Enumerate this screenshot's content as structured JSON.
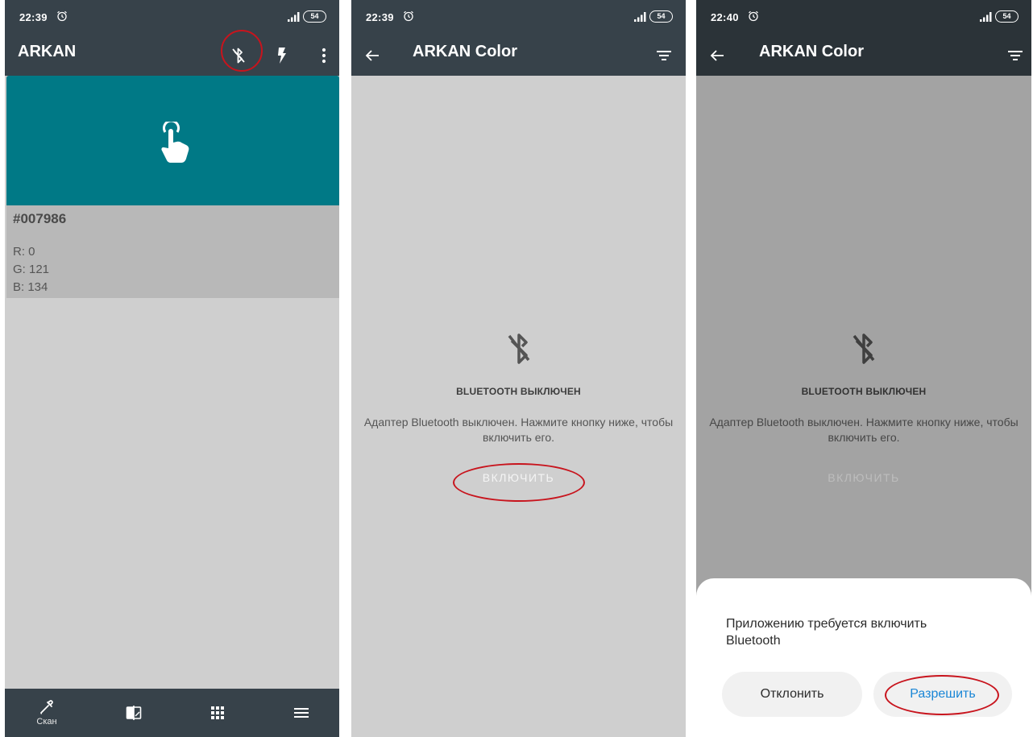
{
  "colors": {
    "bar": "#37424a",
    "swatch": "#007986",
    "highlight": "#c8141d",
    "accent": "#1a86d6"
  },
  "status": {
    "battery": "54"
  },
  "panel1": {
    "time": "22:39",
    "title": "ARKAN",
    "actions": [
      "bluetooth-off-icon",
      "flash-icon",
      "more-vert-icon"
    ],
    "hex": "#007986",
    "r": "R: 0",
    "g": "G: 121",
    "b": "B: 134",
    "nav": {
      "scan_label": "Скан",
      "icons": [
        "eyedropper-icon",
        "compare-icon",
        "grid-icon",
        "menu-icon"
      ]
    }
  },
  "panel2": {
    "time": "22:39",
    "title": "ARKAN Color",
    "bt_title": "BLUETOOTH ВЫКЛЮЧЕН",
    "bt_desc": "Адаптер Bluetooth выключен. Нажмите кнопку ниже, чтобы включить его.",
    "enable_label": "ВКЛЮЧИТЬ"
  },
  "panel3": {
    "time": "22:40",
    "title": "ARKAN Color",
    "bt_title": "BLUETOOTH ВЫКЛЮЧЕН",
    "bt_desc": "Адаптер Bluetooth выключен. Нажмите кнопку ниже, чтобы включить его.",
    "enable_label": "ВКЛЮЧИТЬ",
    "dialog": {
      "message": "Приложению требуется включить Bluetooth",
      "deny_label": "Отклонить",
      "allow_label": "Разрешить"
    }
  }
}
